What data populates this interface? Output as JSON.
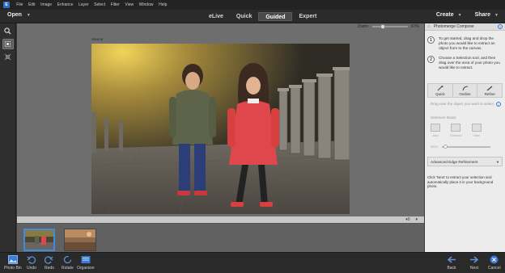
{
  "menubar": {
    "logo": "E",
    "items": [
      "File",
      "Edit",
      "Image",
      "Enhance",
      "Layer",
      "Select",
      "Filter",
      "View",
      "Window",
      "Help"
    ]
  },
  "modebar": {
    "open_label": "Open",
    "tabs": [
      "eLive",
      "Quick",
      "Guided",
      "Expert"
    ],
    "active_tab": "Guided",
    "create_label": "Create",
    "share_label": "Share"
  },
  "canvas": {
    "zoom_label": "Zoom:",
    "zoom_value": "67%",
    "source_label": "Source"
  },
  "strip": {
    "counter": "0"
  },
  "panel": {
    "title": "Photomerge Compose",
    "step1_num": "1",
    "step1_text": "To get started, drag and drop the photo you would like to extract an object from to the canvas.",
    "step2_num": "2",
    "step2_text": "Choose a Selection tool, and then drag over the area of your photo you would like to extract.",
    "sel_quick": "Quick",
    "sel_outline": "Outline",
    "sel_refine": "Refine",
    "drag_hint": "Drag over the object you want to select.",
    "selection_mode_label": "Selection Mode:",
    "mode_add": "Add",
    "mode_subtract": "Subtract",
    "mode_new": "New",
    "size_label": "Size:",
    "advanced_edge": "Advanced Edge Refinement",
    "final_text": "Click 'Next' to extract your selection and automatically place it in your background photo."
  },
  "bottombar": {
    "photo_bin": "Photo Bin",
    "undo": "Undo",
    "redo": "Redo",
    "rotate": "Rotate",
    "organizer": "Organizer",
    "back": "Back",
    "next": "Next",
    "cancel": "Cancel"
  },
  "colors": {
    "accent": "#3a7bd5",
    "coat": "#e0474c",
    "jacket": "#5d6449"
  }
}
